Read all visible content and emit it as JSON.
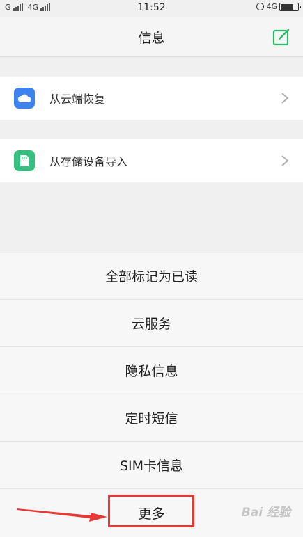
{
  "status_bar": {
    "sim1": "G",
    "sim2": "4G",
    "time": "11:52",
    "network_right": "4G",
    "battery_level": 0.7
  },
  "header": {
    "title": "信息"
  },
  "options": [
    {
      "label": "从云端恢复",
      "icon": "cloud-icon",
      "icon_color": "#3d83f0"
    },
    {
      "label": "从存储设备导入",
      "icon": "sd-card-icon",
      "icon_color": "#35c080"
    }
  ],
  "menu": {
    "items": [
      "全部标记为已读",
      "云服务",
      "隐私信息",
      "定时短信",
      "SIM卡信息",
      "更多"
    ]
  },
  "watermark": "Bai 经验",
  "colors": {
    "accent_green": "#2fb768",
    "highlight_red": "#e53935"
  }
}
